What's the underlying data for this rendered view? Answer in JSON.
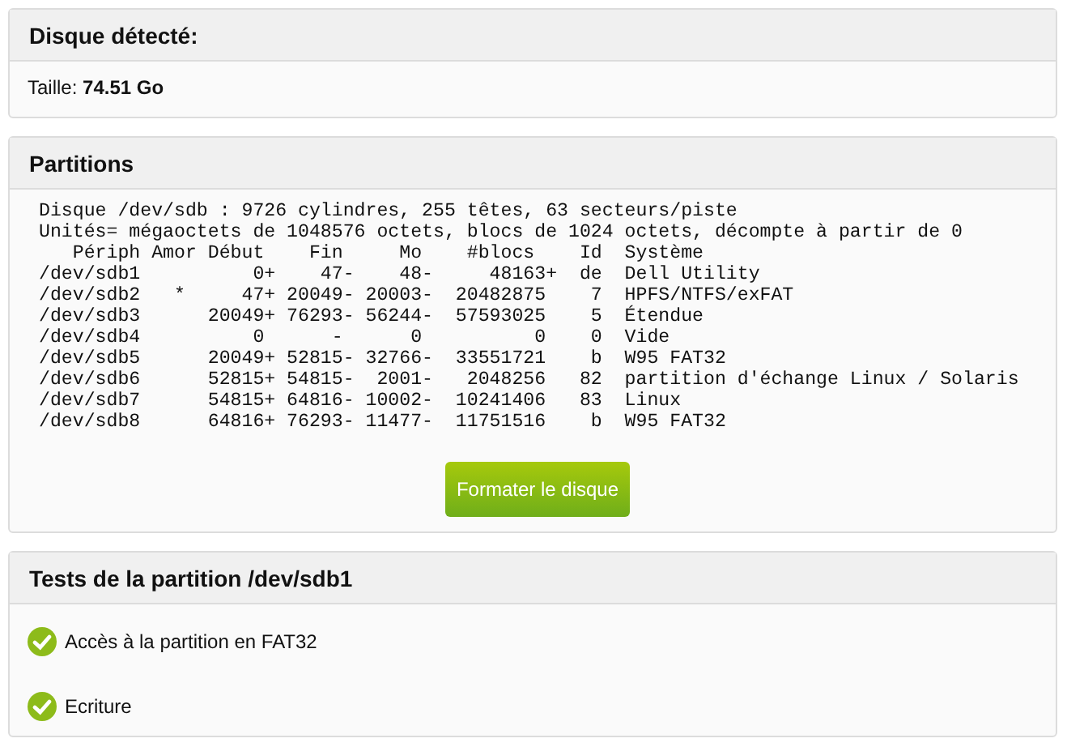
{
  "disk": {
    "title": "Disque détecté:",
    "size": "Taille: **74.51 Go**"
  },
  "partitions": {
    "title": "Partitions",
    "output_lines": [
      "Disque /dev/sdb : 9726 cylindres, 255 têtes, 63 secteurs/piste",
      "Unités= mégaoctets de 1048576 octets, blocs de 1024 octets, décompte à partir de 0",
      "   Périph Amor Début    Fin     Mo    #blocs    Id  Système",
      "/dev/sdb1          0+    47-    48-     48163+  de  Dell Utility",
      "/dev/sdb2   *     47+ 20049- 20003-  20482875    7  HPFS/NTFS/exFAT",
      "/dev/sdb3      20049+ 76293- 56244-  57593025    5  Étendue",
      "/dev/sdb4          0      -      0          0    0  Vide",
      "/dev/sdb5      20049+ 52815- 32766-  33551721    b  W95 FAT32",
      "/dev/sdb6      52815+ 54815-  2001-   2048256   82  partition d'échange Linux / Solaris",
      "/dev/sdb7      54815+ 64816- 10002-  10241406   83  Linux",
      "/dev/sdb8      64816+ 76293- 11477-  11751516    b  W95 FAT32"
    ],
    "button": "Formater le disque"
  },
  "tests": {
    "title": "Tests de la partition /dev/sdb1",
    "items": [
      {
        "label": "Accès à la partition en FAT32",
        "passed": true
      },
      {
        "label": "Ecriture",
        "passed": true
      }
    ]
  }
}
